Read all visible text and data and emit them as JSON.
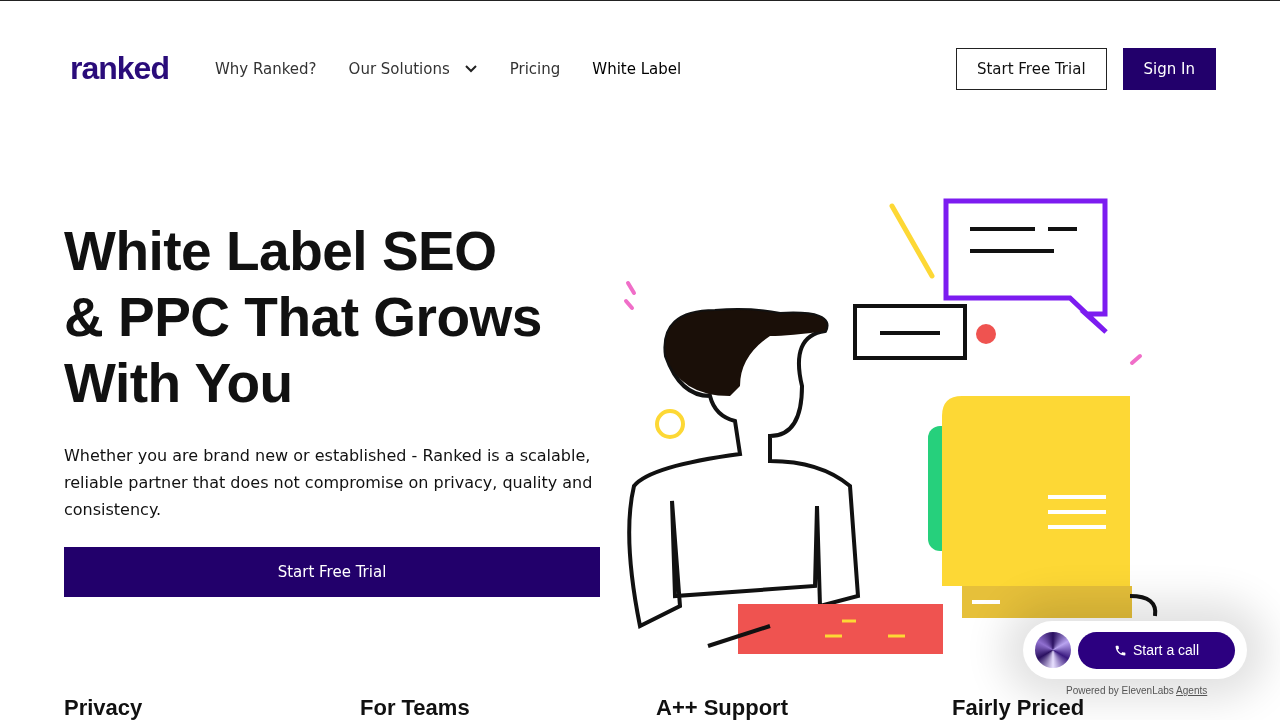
{
  "header": {
    "logo": "ranked",
    "nav": [
      {
        "label": "Why Ranked?",
        "kind": "link",
        "selected": false
      },
      {
        "label": "Our Solutions",
        "kind": "dropdown",
        "selected": false
      },
      {
        "label": "Pricing",
        "kind": "link",
        "selected": false
      },
      {
        "label": "White Label",
        "kind": "link",
        "selected": true
      }
    ],
    "buttons": [
      {
        "label": "Start Free Trial",
        "kind": "outline"
      },
      {
        "label": "Sign In",
        "kind": "solid"
      }
    ]
  },
  "hero": {
    "title_lines": [
      "White Label SEO",
      "& PPC That Grows",
      "With You"
    ],
    "text": "Whether you are brand new or established - Ranked is a scalable, reliable partner that does not compromise on privacy, quality and consistency.",
    "button": "Start Free Trial"
  },
  "features": [
    {
      "title": "Privacy"
    },
    {
      "title": "For Teams"
    },
    {
      "title": "A++ Support"
    },
    {
      "title": "Fairly Priced"
    }
  ],
  "call_widget": {
    "button": "Start a call",
    "powered_by": "Powered by ElevenLabs",
    "link": "Agents"
  }
}
